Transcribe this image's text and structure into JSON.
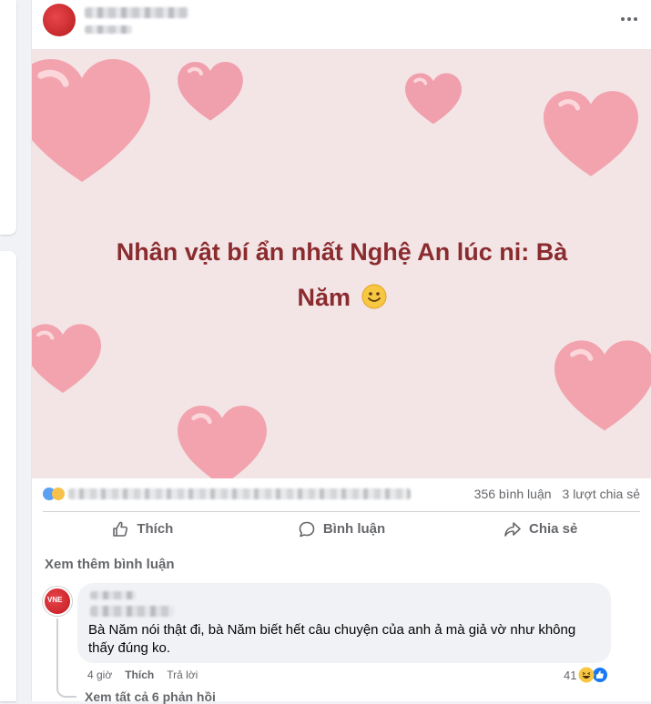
{
  "post": {
    "text_line1": "Nhân vật bí ẩn nhất Nghệ An lúc ni: Bà",
    "text_line2": "Năm",
    "text_emoji": "🙂"
  },
  "stats": {
    "comments": "356 bình luận",
    "shares": "3 lượt chia sẻ"
  },
  "actions": {
    "like": "Thích",
    "comment": "Bình luận",
    "share": "Chia sẻ"
  },
  "comments_section": {
    "more_comments": "Xem thêm bình luận",
    "comment": {
      "text": "Bà Năm nói thật đi, bà Năm biết hết câu chuyện của anh ả mà giả vờ như không thấy đúng ko.",
      "time": "4 giờ",
      "like": "Thích",
      "reply": "Trả lời",
      "reaction_count": "41",
      "avatar_logo": "VNE"
    },
    "view_replies": "Xem tất cả 6 phản hồi"
  },
  "colors": {
    "post_text": "#8a2b2e",
    "background_pink": "#f3e4e6",
    "heart": "#f3a5b0"
  },
  "icons": {
    "like": "thumbs-up-icon",
    "comment": "speech-bubble-icon",
    "share": "share-arrow-icon",
    "more": "more-dots-icon"
  }
}
